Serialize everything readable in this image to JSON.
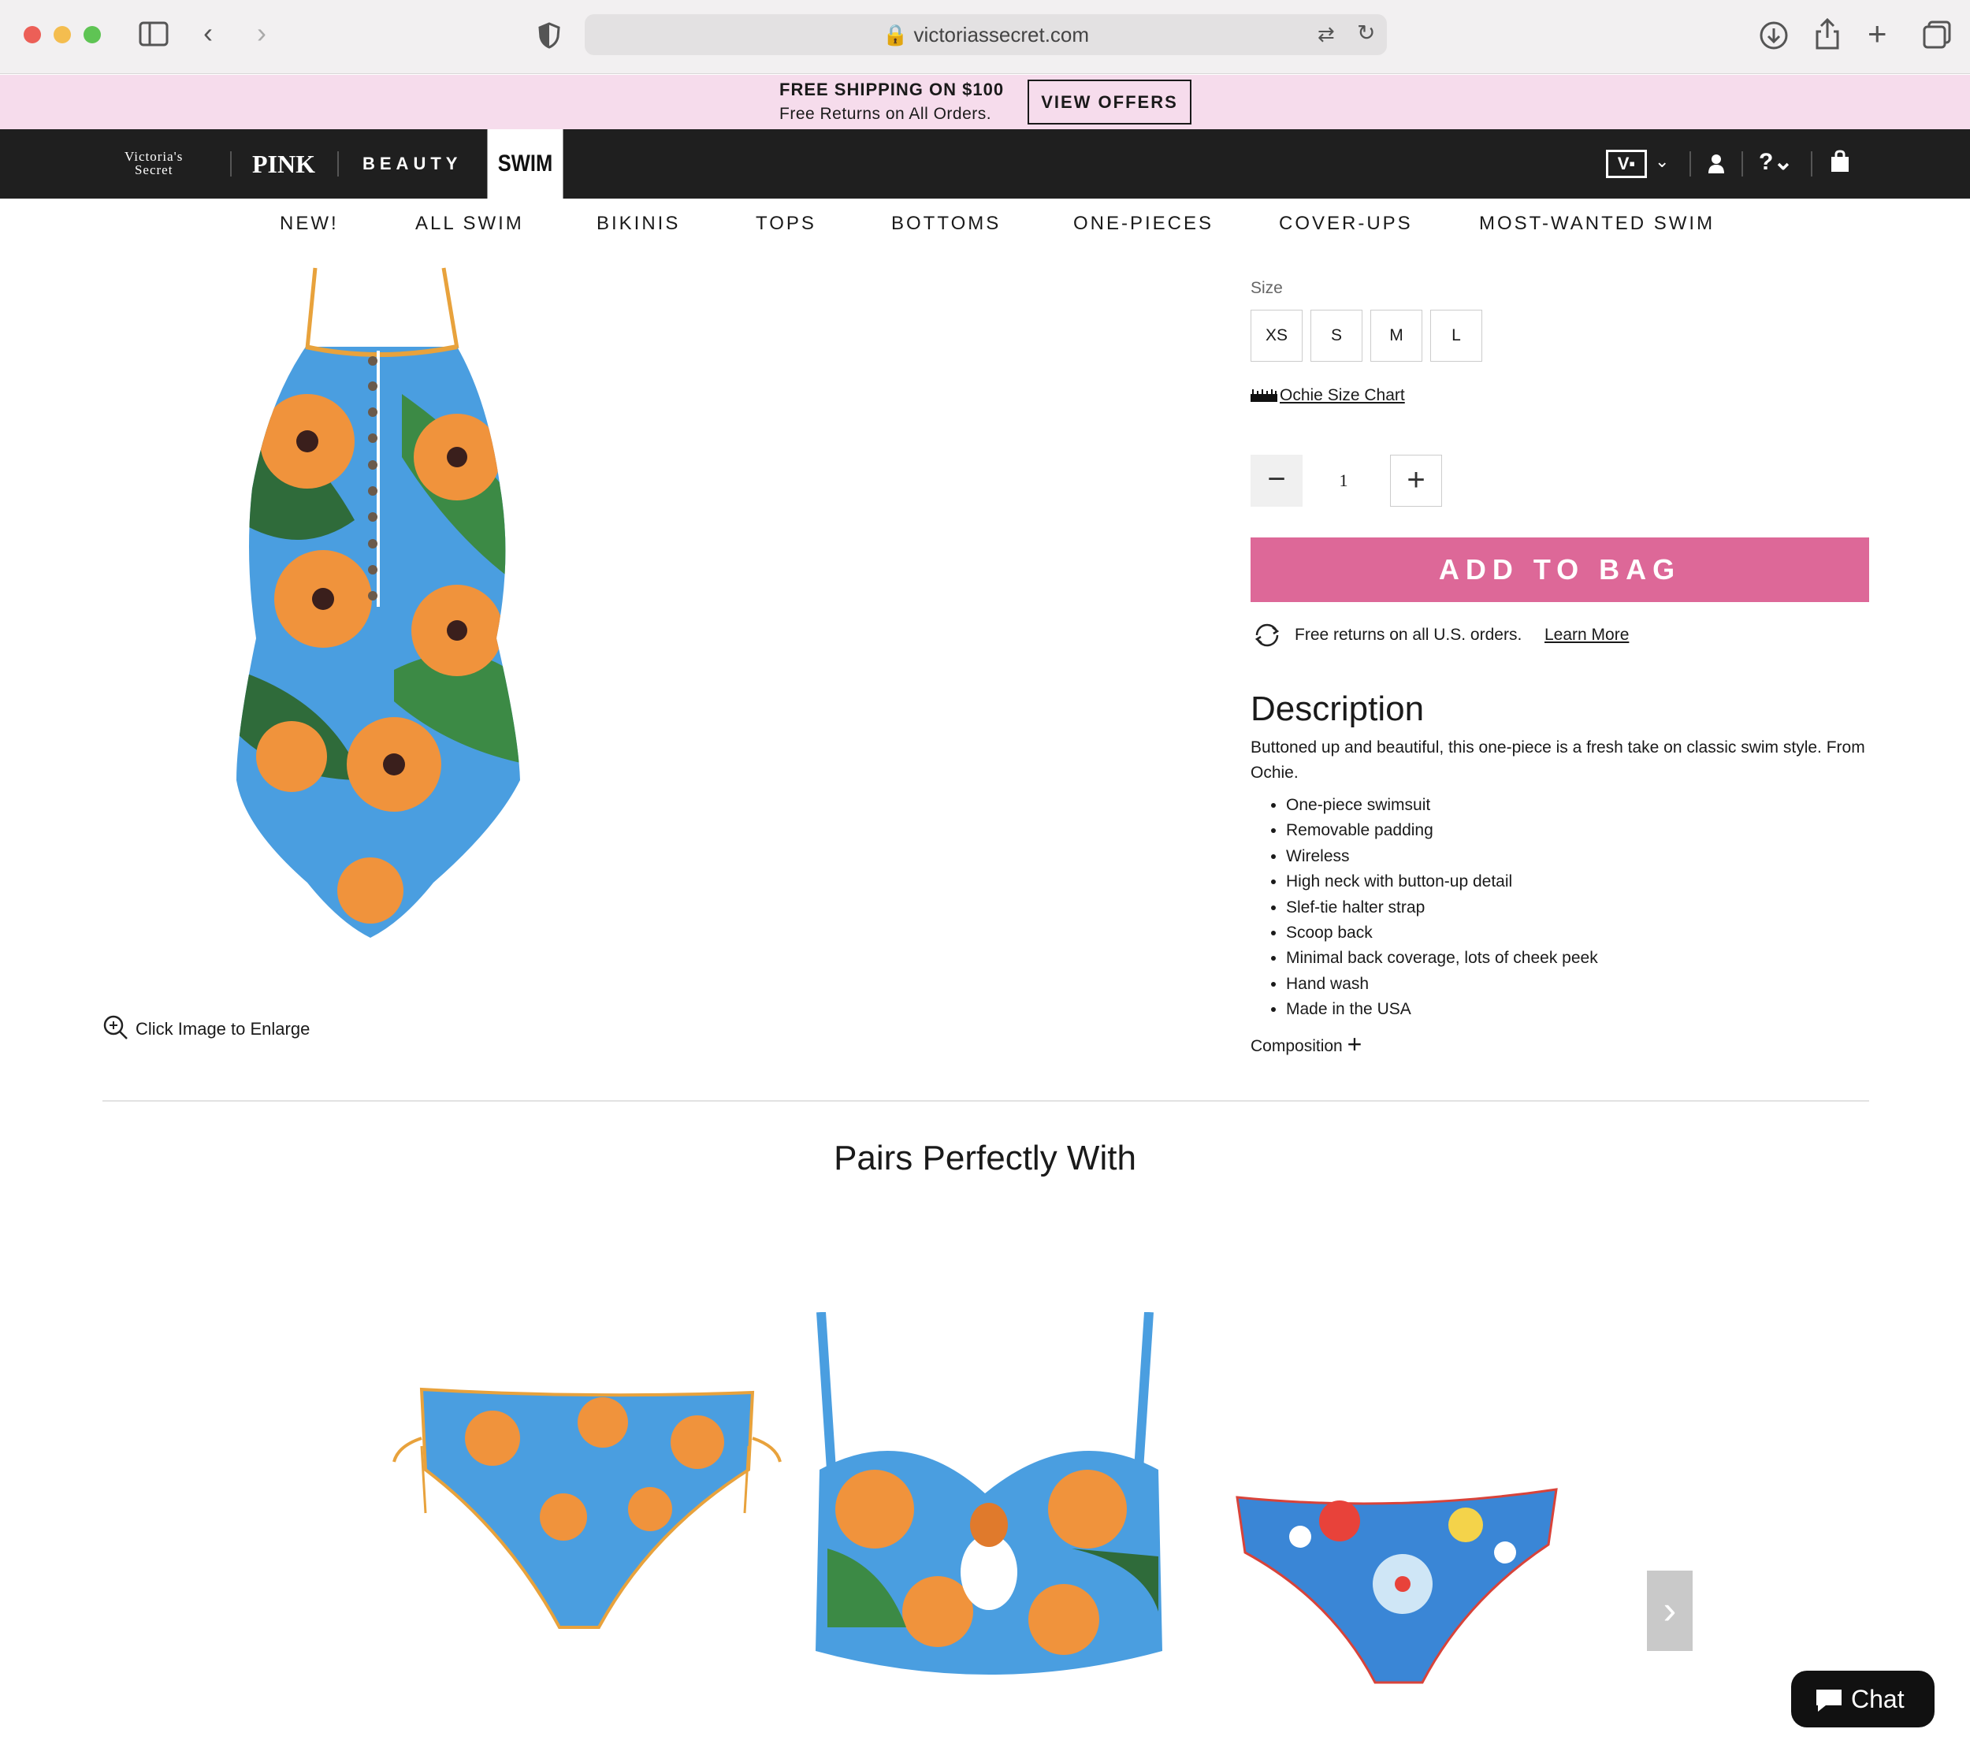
{
  "browser": {
    "url": "victoriassecret.com"
  },
  "promo": {
    "title": "FREE SHIPPING ON $100",
    "subtitle": "Free Returns on All Orders.",
    "button": "VIEW OFFERS"
  },
  "brands": {
    "vs_line1": "Victoria's",
    "vs_line2": "Secret",
    "pink": "PINK",
    "beauty": "BEAUTY",
    "swim": "SWIM"
  },
  "subnav": [
    "NEW!",
    "ALL SWIM",
    "BIKINIS",
    "TOPS",
    "BOTTOMS",
    "ONE-PIECES",
    "COVER-UPS",
    "MOST-WANTED SWIM"
  ],
  "product": {
    "size_label": "Size",
    "sizes": [
      "XS",
      "S",
      "M",
      "L"
    ],
    "size_chart": "Ochie Size Chart",
    "quantity": "1",
    "add_to_bag": "ADD TO BAG",
    "returns_text": "Free returns on all U.S. orders.",
    "returns_link": "Learn More",
    "enlarge": "Click Image to Enlarge"
  },
  "description": {
    "title": "Description",
    "text": "Buttoned up and beautiful, this one-piece is a fresh take on classic swim style. From Ochie.",
    "bullets": [
      "One-piece swimsuit",
      "Removable padding",
      "Wireless",
      "High neck with button-up detail",
      "Slef-tie halter strap",
      "Scoop back",
      "Minimal back coverage, lots of cheek peek",
      "Hand wash",
      "Made in the USA"
    ],
    "composition": "Composition"
  },
  "pairs": {
    "title": "Pairs Perfectly With"
  },
  "chat": {
    "label": "Chat"
  },
  "colors": {
    "accent": "#dd6898",
    "promo_bg": "#f6dcec",
    "nav_bg": "#1f1f1f"
  }
}
